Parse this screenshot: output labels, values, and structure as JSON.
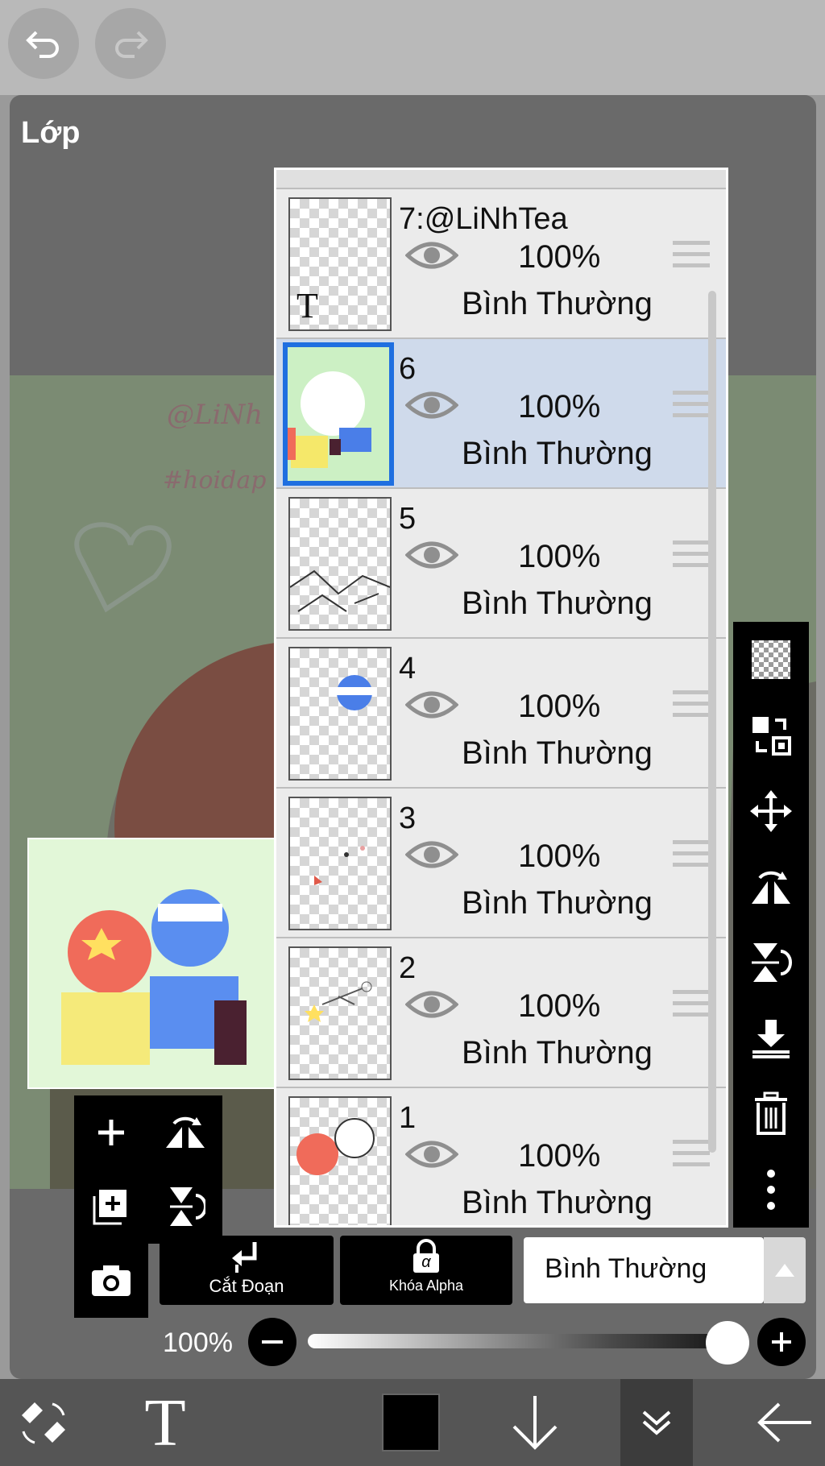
{
  "panel": {
    "title": "Lớp"
  },
  "top_bar": {
    "undo_icon": "undo-icon",
    "redo_icon": "redo-icon"
  },
  "layers": [
    {
      "name": "7:@LiNhTea",
      "opacity": "100%",
      "blend": "Bình Thường",
      "selected": false
    },
    {
      "name": "6",
      "opacity": "100%",
      "blend": "Bình Thường",
      "selected": true
    },
    {
      "name": "5",
      "opacity": "100%",
      "blend": "Bình Thường",
      "selected": false
    },
    {
      "name": "4",
      "opacity": "100%",
      "blend": "Bình Thường",
      "selected": false
    },
    {
      "name": "3",
      "opacity": "100%",
      "blend": "Bình Thường",
      "selected": false
    },
    {
      "name": "2",
      "opacity": "100%",
      "blend": "Bình Thường",
      "selected": false
    },
    {
      "name": "1",
      "opacity": "100%",
      "blend": "Bình Thường",
      "selected": false
    }
  ],
  "layer_thumb_text": "T",
  "controls": {
    "clip_label": "Cắt Đoạn",
    "alpha_lock_label": "Khóa Alpha",
    "alpha_glyph": "α",
    "blend_mode": "Bình Thường",
    "opacity_label": "100%",
    "opacity_value": 1.0
  },
  "bottom_bar": {
    "text_tool_glyph": "T",
    "color": "#000000"
  },
  "canvas_text": {
    "watermark": "@LiNh",
    "hashtag": "#hoidap"
  },
  "colors": {
    "selected_row": "#cfdaeb",
    "selected_border": "#1f6fe0"
  }
}
